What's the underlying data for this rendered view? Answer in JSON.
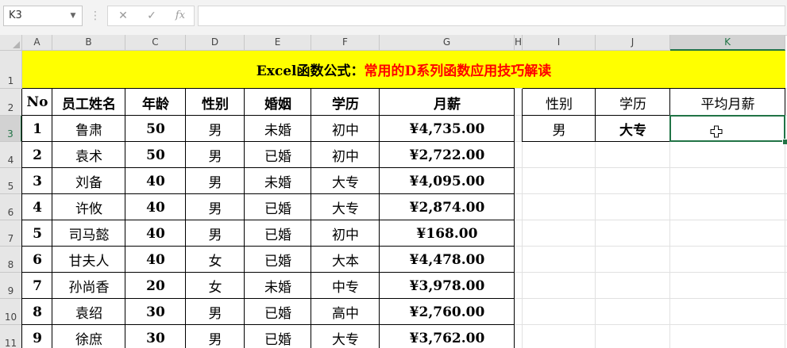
{
  "formula_bar": {
    "name_box": "K3",
    "cancel_symbol": "✕",
    "enter_symbol": "✓",
    "fx_label": "fx",
    "formula": ""
  },
  "grid": {
    "columns": [
      "A",
      "B",
      "C",
      "D",
      "E",
      "F",
      "G",
      "H",
      "I",
      "J",
      "K"
    ],
    "rows": [
      "1",
      "2",
      "3",
      "4",
      "5",
      "6",
      "7",
      "8",
      "9",
      "10",
      "11"
    ],
    "selected_column": "K",
    "selected_row": "3"
  },
  "title": {
    "part1": "Excel函数公式：",
    "part2": "常用的D系列函数应用技巧解读",
    "fill_color": "#ffff00",
    "part2_color": "#ff0000"
  },
  "table": {
    "headers": [
      "No",
      "员工姓名",
      "年龄",
      "性别",
      "婚姻",
      "学历",
      "月薪"
    ],
    "rows": [
      [
        "1",
        "鲁肃",
        "50",
        "男",
        "未婚",
        "初中",
        "¥4,735.00"
      ],
      [
        "2",
        "袁术",
        "50",
        "男",
        "已婚",
        "初中",
        "¥2,722.00"
      ],
      [
        "3",
        "刘备",
        "40",
        "男",
        "未婚",
        "大专",
        "¥4,095.00"
      ],
      [
        "4",
        "许攸",
        "40",
        "男",
        "已婚",
        "大专",
        "¥2,874.00"
      ],
      [
        "5",
        "司马懿",
        "40",
        "男",
        "已婚",
        "初中",
        "¥168.00"
      ],
      [
        "6",
        "甘夫人",
        "40",
        "女",
        "已婚",
        "大本",
        "¥4,478.00"
      ],
      [
        "7",
        "孙尚香",
        "20",
        "女",
        "未婚",
        "中专",
        "¥3,978.00"
      ],
      [
        "8",
        "袁绍",
        "30",
        "男",
        "已婚",
        "高中",
        "¥2,760.00"
      ],
      [
        "9",
        "徐庶",
        "30",
        "男",
        "已婚",
        "大专",
        "¥3,762.00"
      ]
    ]
  },
  "criteria": {
    "headers": [
      "性别",
      "学历",
      "平均月薪"
    ],
    "values": [
      "男",
      "大专",
      ""
    ]
  },
  "accent_color": "#217346"
}
